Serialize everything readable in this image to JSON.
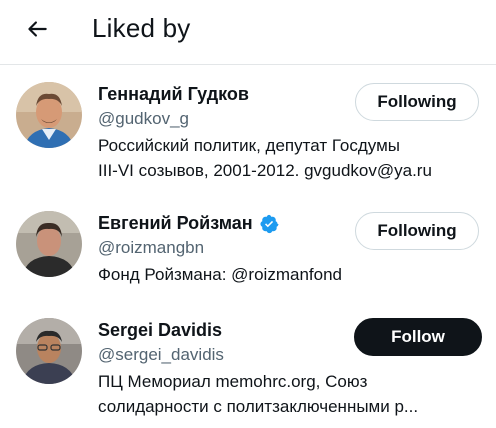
{
  "header": {
    "title": "Liked by",
    "back_icon": "arrow-left-icon"
  },
  "users": [
    {
      "name": "Геннадий Гудков",
      "handle": "@gudkov_g",
      "verified": false,
      "bio_line1": "Российский политик, депутат Госдумы",
      "bio_line2": "III-VI созывов, 2001-2012. gvgudkov@ya.ru",
      "button_label": "Following",
      "button_state": "following"
    },
    {
      "name": "Евгений Ройзман",
      "handle": "@roizmangbn",
      "verified": true,
      "bio_line1": "Фонд Ройзмана: @roizmanfond",
      "bio_line2": "",
      "button_label": "Following",
      "button_state": "following"
    },
    {
      "name": "Sergei Davidis",
      "handle": "@sergei_davidis",
      "verified": false,
      "bio_line1": "ПЦ Мемориал memohrc.org, Союз",
      "bio_line2": "солидарности с политзаключенными р...",
      "button_label": "Follow",
      "button_state": "not-following"
    }
  ],
  "colors": {
    "text_primary": "#0f1419",
    "text_secondary": "#536471",
    "verified_blue": "#1d9bf0",
    "follow_button_bg": "#0f1419",
    "border": "#cfd9de"
  }
}
